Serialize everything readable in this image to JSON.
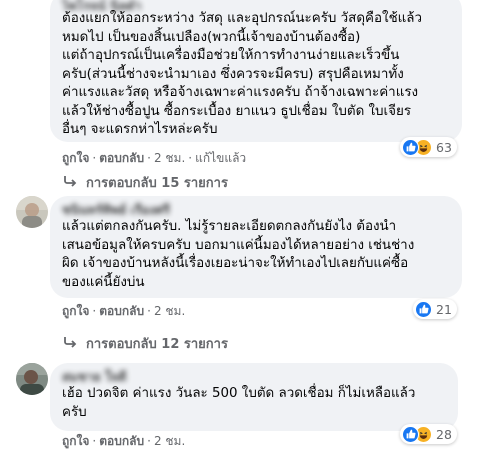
{
  "comments": [
    {
      "author": "ไพโรจน์ นิลดำ",
      "lines": [
        "ต้องแยกให้ออกระหว่าง วัสดุ และอุปกรณ์นะครับ วัสดุคือใช้แล้ว",
        "หมดไป เป็นของสิ้นเปลือง(พวกนี้เจ้าของบ้านต้องซื้อ)",
        "แต่ถ้าอุปกรณ์เป็นเครื่องมือช่วยให้การทำงานง่ายและเร็วขึ้น",
        "ครับ(ส่วนนี้ช่างจะนำมาเอง ซึ่งควรจะมีครบ) สรุปคือเหมาทั้ง",
        "ค่าแรงและวัสดุ หรือจ้างเฉพาะค่าแรงครับ ถ้าจ้างเฉพาะค่าแรง",
        "แล้วให้ช่างซื้อปูน ซื้อกระเบื้อง ยาแนว ธูปเชื่อม ใบตัด ใบเจียร",
        "อื่นๆ จะแดรกห่าไรหล่ะครับ"
      ],
      "like_label": "ถูกใจ",
      "reply_label": "ตอบกลับ",
      "time": "2 ชม.",
      "edited": "แก้ไขแล้ว",
      "reaction_count": "63",
      "replies": "การตอบกลับ 15 รายการ"
    },
    {
      "author": "ชนินทร์ทิพย์ เรืองศรี",
      "lines": [
        "แล้วแต่ตกลงกันครับ. ไม่รู้รายละเอียดตกลงกันยังไง ต้องนำ",
        "เสนอข้อมูลให้ครบครับ บอกมาแค่นี้มองได้หลายอย่าง เช่นช่าง",
        "ผิด เจ้าของบ้านหลังนี้เรื่องเยอะน่าจะให้ทำเองไปเลยกับแค่ซื้อ",
        "ของแค่นี้ยังบ่น"
      ],
      "like_label": "ถูกใจ",
      "reply_label": "ตอบกลับ",
      "time": "2 ชม.",
      "reaction_count": "21",
      "replies": "การตอบกลับ 12 รายการ"
    },
    {
      "author": "สมชาย ใจดี",
      "lines": [
        "เฮ้อ ปวดจิต ค่าแรง วันละ 500 ใบตัด ลวดเชื่อม ก็ไม่เหลือแล้ว",
        "ครับ"
      ],
      "like_label": "ถูกใจ",
      "reply_label": "ตอบกลับ",
      "time": "2 ชม.",
      "reaction_count": "28"
    }
  ],
  "colors": {
    "bubble": "#f0f2f5",
    "like": "#1877f2",
    "haha": "#f7b125",
    "secondary_text": "#65676b"
  },
  "icons": [
    "like-icon",
    "haha-icon",
    "reply-arrow-icon"
  ]
}
